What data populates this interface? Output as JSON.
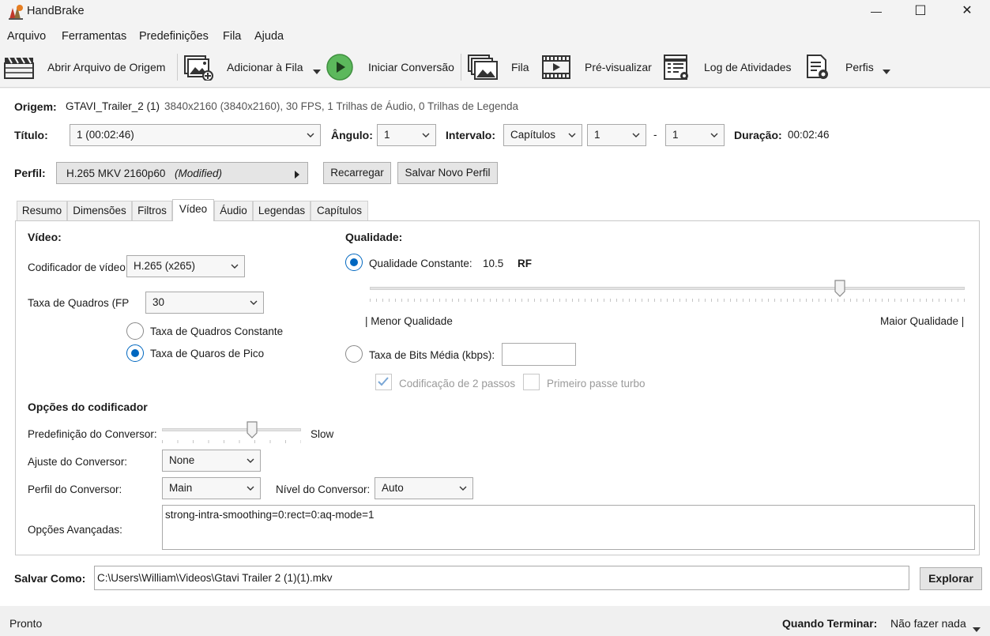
{
  "app": {
    "title": "HandBrake"
  },
  "window_controls": {
    "minimize": "—",
    "maximize": "☐",
    "close": "✕"
  },
  "menu": [
    "Arquivo",
    "Ferramentas",
    "Predefinições",
    "Fila",
    "Ajuda"
  ],
  "toolbar": {
    "open_source": "Abrir Arquivo de Origem",
    "add_queue": "Adicionar à Fila",
    "start": "Iniciar Conversão",
    "queue": "Fila",
    "preview": "Pré-visualizar",
    "activity_log": "Log de Atividades",
    "presets": "Perfis"
  },
  "source": {
    "label": "Origem:",
    "name": "GTAVI_Trailer_2 (1)",
    "info": "3840x2160 (3840x2160), 30 FPS, 1 Trilhas de Áudio, 0 Trilhas de Legenda"
  },
  "title_row": {
    "title_label": "Título:",
    "title_value": "1  (00:02:46)",
    "angle_label": "Ângulo:",
    "angle_value": "1",
    "range_label": "Intervalo:",
    "range_type": "Capítulos",
    "range_start": "1",
    "range_sep": "-",
    "range_end": "1",
    "duration_label": "Duração:",
    "duration_value": "00:02:46"
  },
  "preset_row": {
    "label": "Perfil:",
    "name": "H.265 MKV 2160p60",
    "modified": "(Modified)",
    "reload": "Recarregar",
    "save_new": "Salvar Novo Perfil"
  },
  "tabs": [
    "Resumo",
    "Dimensões",
    "Filtros",
    "Vídeo",
    "Áudio",
    "Legendas",
    "Capítulos"
  ],
  "active_tab": "Vídeo",
  "video": {
    "section": "Vídeo:",
    "encoder_label": "Codificador de vídeo",
    "encoder_value": "H.265 (x265)",
    "fps_label": "Taxa de Quadros (FP",
    "fps_value": "30",
    "fps_constant": "Taxa de Quadros Constante",
    "fps_peak": "Taxa de Quaros de Pico"
  },
  "quality": {
    "section": "Qualidade:",
    "constant_label": "Qualidade Constante:",
    "rf_value": "10.5",
    "rf_unit": "RF",
    "slider_fraction": 0.79,
    "low_label": "| Menor Qualidade",
    "high_label": "Maior Qualidade |",
    "bitrate_label": "Taxa de Bits Média (kbps):",
    "bitrate_value": "",
    "two_pass": "Codificação de 2 passos",
    "turbo": "Primeiro passe turbo"
  },
  "encoder_options": {
    "section": "Opções do codificador",
    "preset_label": "Predefinição do Conversor:",
    "preset_value": "Slow",
    "preset_fraction": 0.65,
    "tune_label": "Ajuste do Conversor:",
    "tune_value": "None",
    "profile_label": "Perfil do Conversor:",
    "profile_value": "Main",
    "level_label": "Nível do Conversor:",
    "level_value": "Auto",
    "advanced_label": "Opções Avançadas:",
    "advanced_value": "strong-intra-smoothing=0:rect=0:aq-mode=1"
  },
  "save": {
    "label": "Salvar Como:",
    "path": "C:\\Users\\William\\Videos\\Gtavi Trailer 2 (1)(1).mkv",
    "browse": "Explorar"
  },
  "status": {
    "text": "Pronto",
    "when_done_label": "Quando Terminar:",
    "when_done_value": "Não fazer nada"
  },
  "colors": {
    "accent": "#0067c0",
    "start_green": "#5cb85c"
  }
}
